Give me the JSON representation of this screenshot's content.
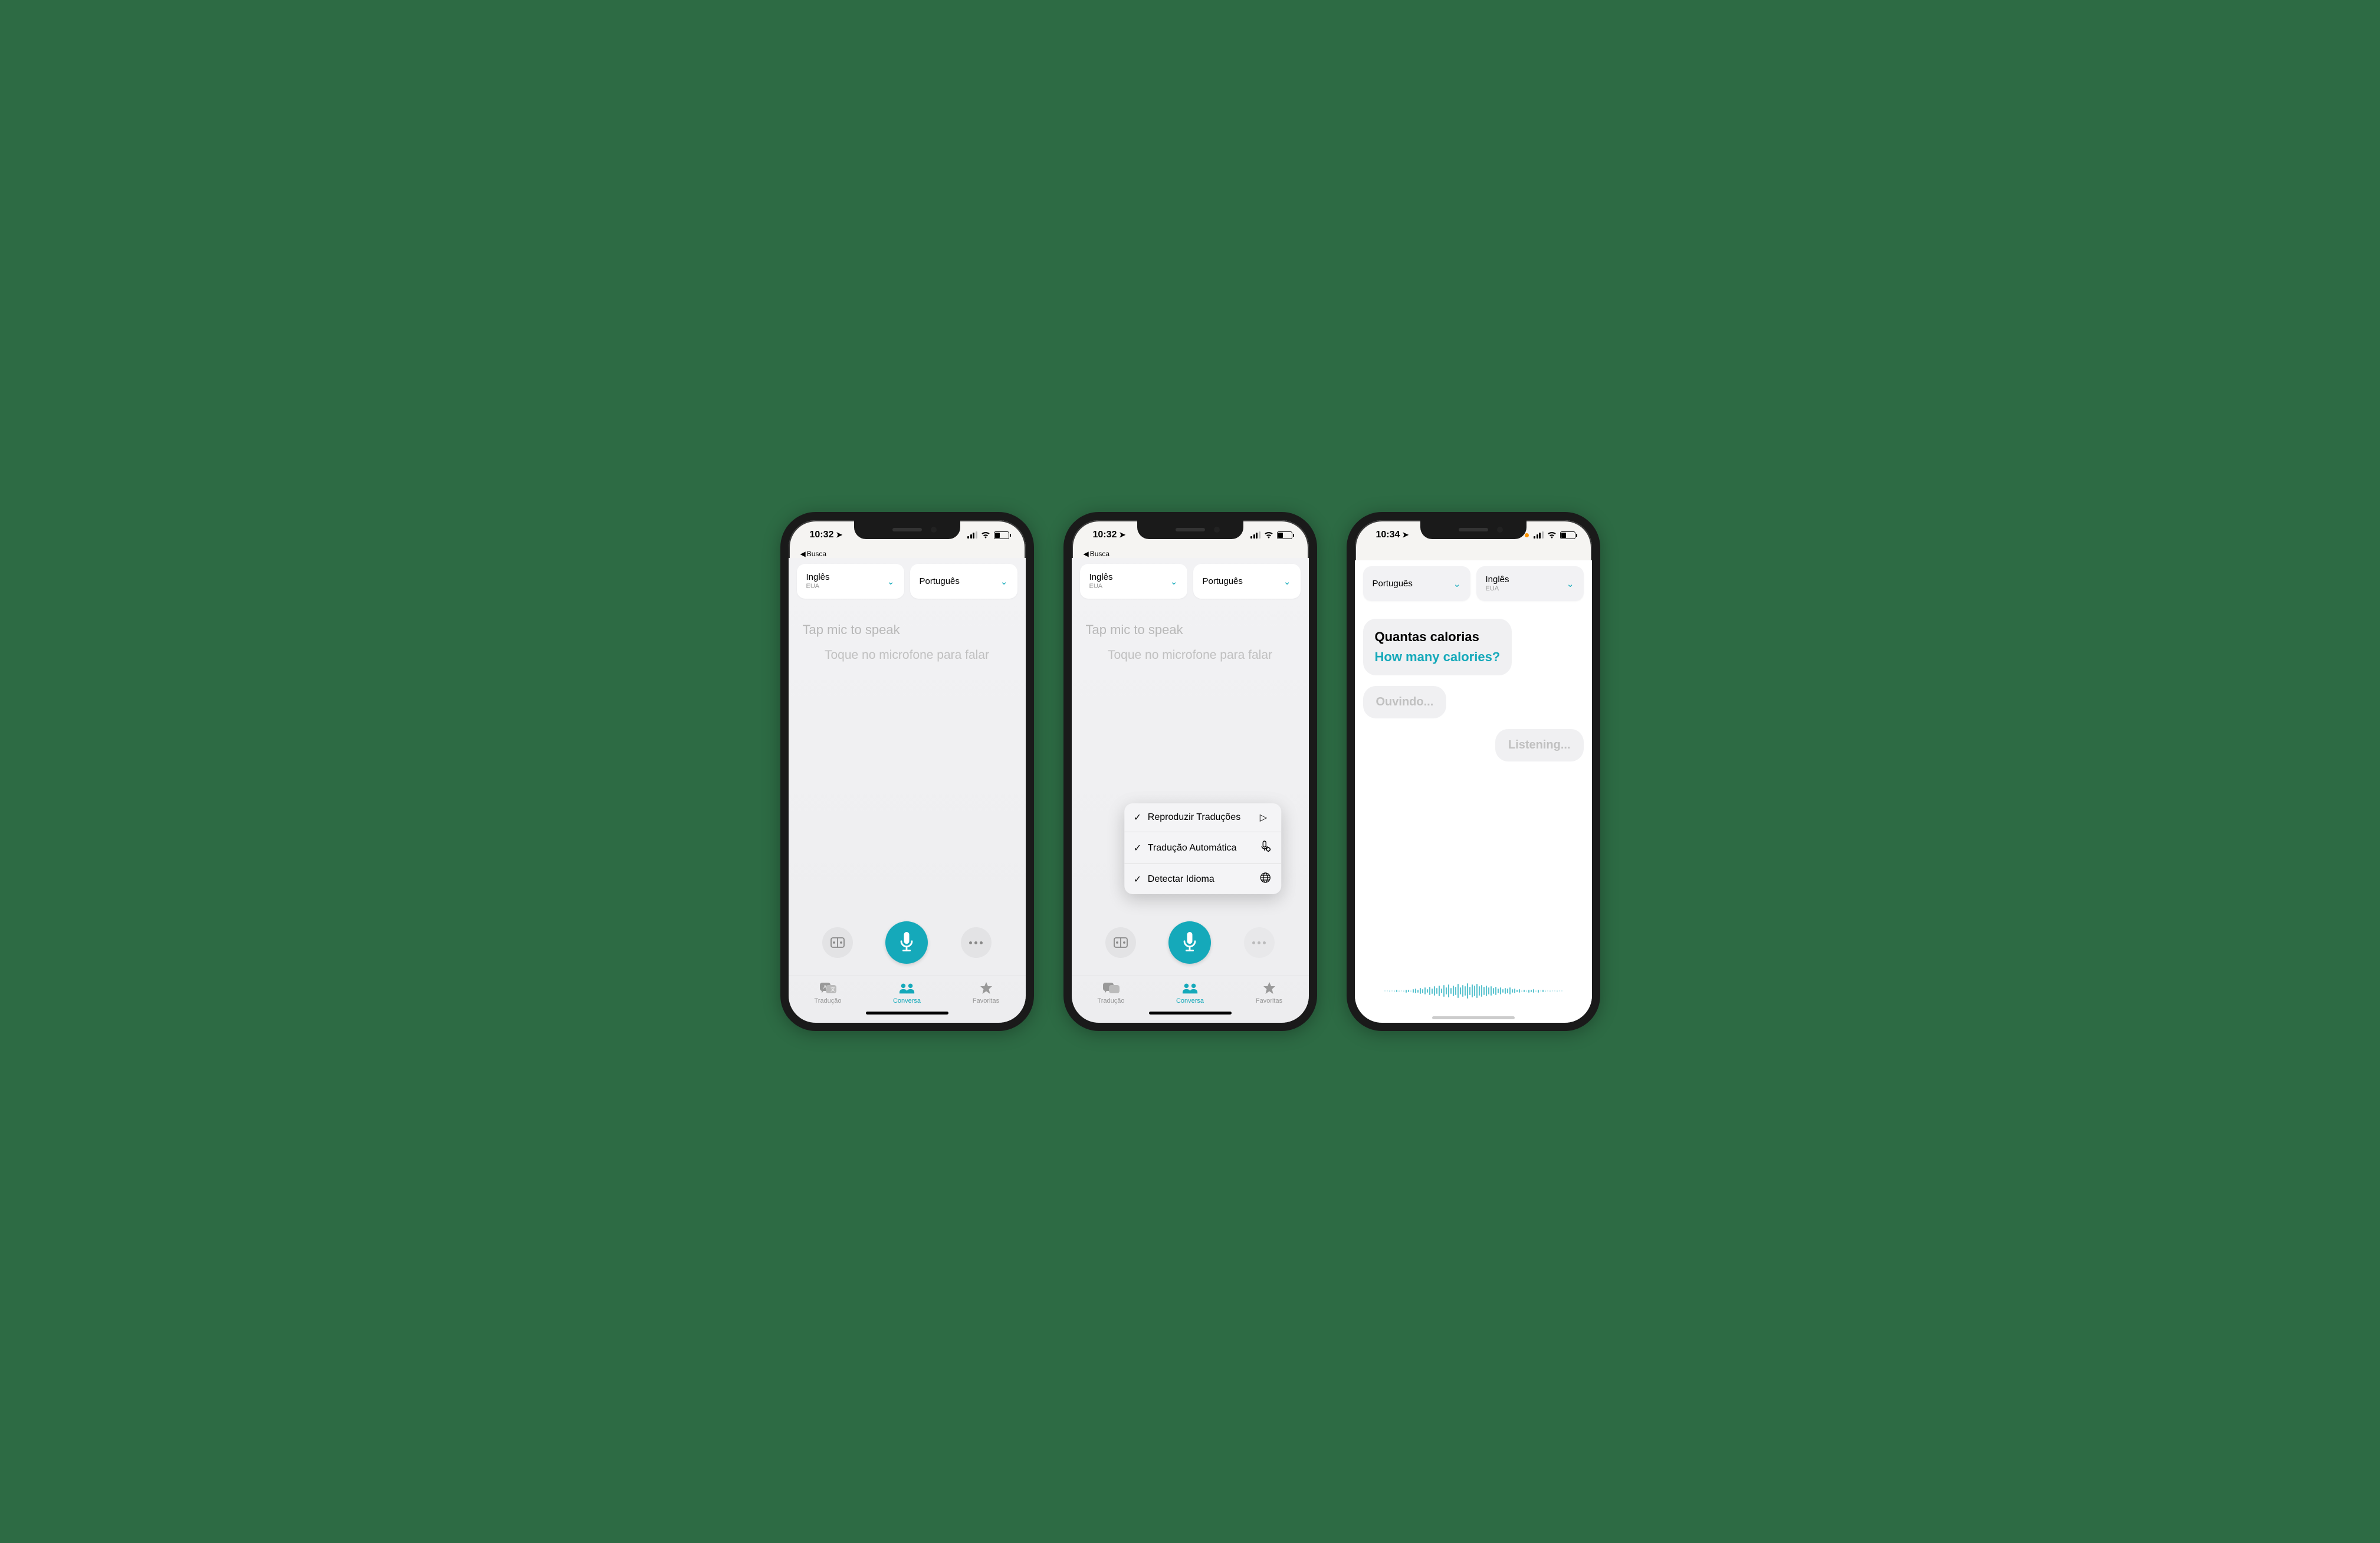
{
  "colors": {
    "accent": "#15a9ba",
    "bg": "#2d6b44"
  },
  "phones": [
    {
      "status": {
        "time": "10:32",
        "back_label": "Busca",
        "orange_dot": false
      },
      "lang_left": {
        "name": "Inglês",
        "sub": "EUA"
      },
      "lang_right": {
        "name": "Português",
        "sub": ""
      },
      "prompt_en": "Tap mic to speak",
      "prompt_pt": "Toque no microfone para falar",
      "tabs": [
        {
          "label": "Tradução",
          "active": false,
          "icon": "translation"
        },
        {
          "label": "Conversa",
          "active": true,
          "icon": "conversation"
        },
        {
          "label": "Favoritas",
          "active": false,
          "icon": "star"
        }
      ],
      "show_menu": false
    },
    {
      "status": {
        "time": "10:32",
        "back_label": "Busca",
        "orange_dot": false
      },
      "lang_left": {
        "name": "Inglês",
        "sub": "EUA"
      },
      "lang_right": {
        "name": "Português",
        "sub": ""
      },
      "prompt_en": "Tap mic to speak",
      "prompt_pt": "Toque no microfone para falar",
      "tabs": [
        {
          "label": "Tradução",
          "active": false,
          "icon": "translation"
        },
        {
          "label": "Conversa",
          "active": true,
          "icon": "conversation"
        },
        {
          "label": "Favoritas",
          "active": false,
          "icon": "star"
        }
      ],
      "show_menu": true,
      "menu": [
        {
          "checked": true,
          "label": "Reproduzir Traduções",
          "icon": "play"
        },
        {
          "checked": true,
          "label": "Tradução Automática",
          "icon": "mic-gear"
        },
        {
          "checked": true,
          "label": "Detectar Idioma",
          "icon": "globe"
        }
      ]
    },
    {
      "status": {
        "time": "10:34",
        "back_label": "",
        "orange_dot": true
      },
      "lang_left": {
        "name": "Português",
        "sub": ""
      },
      "lang_right": {
        "name": "Inglês",
        "sub": "EUA"
      },
      "chat": {
        "main": {
          "orig": "Quantas calorias",
          "trans": "How many calories?"
        },
        "left_bubble": "Ouvindo...",
        "right_bubble": "Listening..."
      }
    }
  ]
}
